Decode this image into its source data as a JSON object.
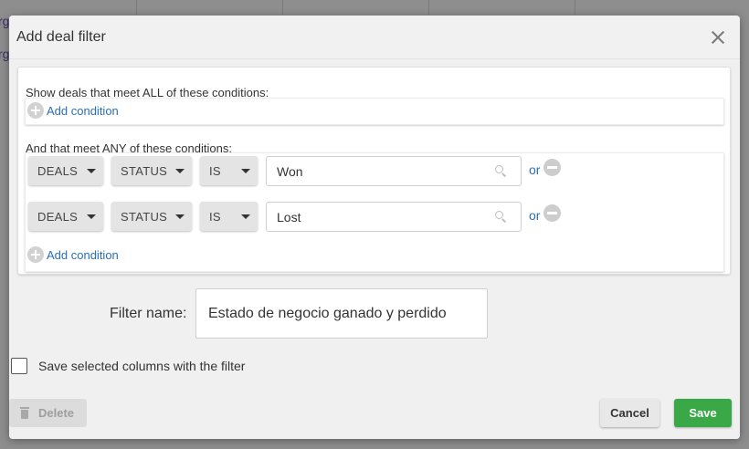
{
  "background": {
    "row_fragments": [
      "rg",
      "rg"
    ]
  },
  "dialog": {
    "title": "Add deal filter"
  },
  "conditions": {
    "all_label": "Show deals that meet ALL of these conditions:",
    "add_condition_label": "Add condition",
    "any_label": "And that meet ANY of these conditions:",
    "any_rows": [
      {
        "entity": "DEALS",
        "field": "STATUS",
        "operator": "IS",
        "value": "Won",
        "or_label": "or"
      },
      {
        "entity": "DEALS",
        "field": "STATUS",
        "operator": "IS",
        "value": "Lost",
        "or_label": "or"
      }
    ]
  },
  "filter_name": {
    "label": "Filter name:",
    "value": "Estado de negocio ganado y perdido"
  },
  "save_columns": {
    "label": "Save selected columns with the filter",
    "checked": false
  },
  "footer": {
    "delete_label": "Delete",
    "cancel_label": "Cancel",
    "save_label": "Save"
  },
  "colors": {
    "link": "#2a6fb5",
    "save_button": "#3aa847",
    "overlay": "#8e8e8e"
  }
}
